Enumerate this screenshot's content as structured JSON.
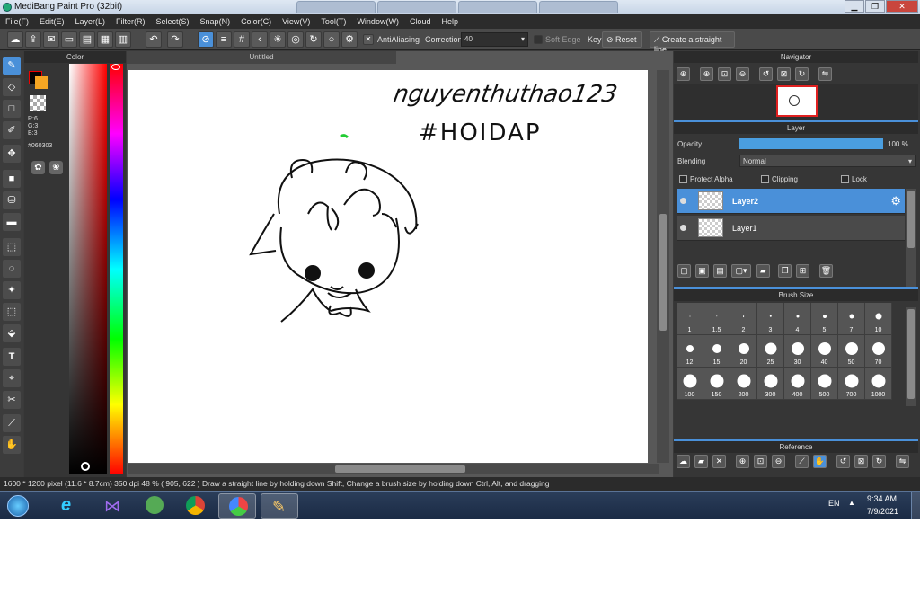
{
  "window": {
    "title": "MediBang Paint Pro (32bit)"
  },
  "menu": [
    "File(F)",
    "Edit(E)",
    "Layer(L)",
    "Filter(R)",
    "Select(S)",
    "Snap(N)",
    "Color(C)",
    "View(V)",
    "Tool(T)",
    "Window(W)",
    "Cloud",
    "Help"
  ],
  "toolbar": {
    "antialiasing_label": "AntiAliasing",
    "correction_label": "Correction",
    "correction_value": "40",
    "soft_edge_label": "Soft Edge",
    "key_label": "Key",
    "reset_label": "Reset",
    "straight_line_label": "Create a straight line"
  },
  "color_panel": {
    "title": "Color",
    "r": "R:6",
    "g": "G:3",
    "b": "B:3",
    "hex": "#060303",
    "fg": "#060303",
    "bg": "#f5a623"
  },
  "document": {
    "tab_title": "Untitled",
    "handwriting_line1": "nguyenthuthao123",
    "handwriting_line2": "#HOIDAP"
  },
  "navigator": {
    "title": "Navigator"
  },
  "layer_panel": {
    "title": "Layer",
    "opacity_label": "Opacity",
    "opacity_value": "100 %",
    "opacity_fraction": 1.0,
    "blending_label": "Blending",
    "blending_value": "Normal",
    "protect_alpha": "Protect Alpha",
    "clipping": "Clipping",
    "lock": "Lock",
    "layers": [
      {
        "name": "Layer2",
        "selected": true
      },
      {
        "name": "Layer1",
        "selected": false
      }
    ]
  },
  "brush_size": {
    "title": "Brush Size",
    "sizes": [
      "1",
      "1.5",
      "2",
      "3",
      "4",
      "5",
      "7",
      "10",
      "12",
      "15",
      "20",
      "25",
      "30",
      "40",
      "50",
      "70",
      "100",
      "150",
      "200",
      "300",
      "400",
      "500",
      "700",
      "1000"
    ]
  },
  "reference": {
    "title": "Reference"
  },
  "status": "1600 * 1200 pixel   (11.6 * 8.7cm)  350 dpi   48 %   ( 905, 622 )   Draw a straight line by holding down Shift, Change a brush size by holding down Ctrl, Alt, and dragging",
  "taskbar": {
    "language": "EN",
    "time": "9:34 AM",
    "date": "7/9/2021"
  }
}
